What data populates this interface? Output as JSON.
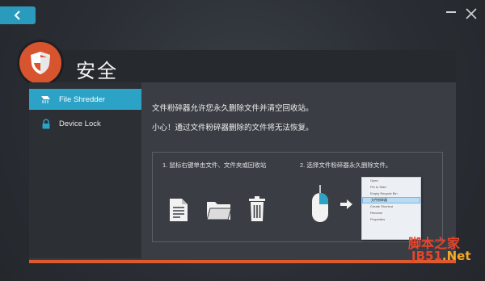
{
  "window": {
    "back_icon": "chevron-left-icon",
    "minimize_icon": "minimize-icon",
    "close_icon": "close-icon"
  },
  "header": {
    "title": "安全",
    "badge_icon": "shield-icon",
    "badge_color": "#d8542f"
  },
  "sidebar": {
    "items": [
      {
        "label": "File Shredder",
        "icon": "shredder-icon",
        "active": true
      },
      {
        "label": "Device Lock",
        "icon": "lock-icon",
        "active": false
      }
    ],
    "accent": "#2ca2c6"
  },
  "content": {
    "line1": "文件粉碎器允许您永久删除文件并清空回收站。",
    "line2": "小心！通过文件粉碎器删除的文件将无法恢复。",
    "step1": "1. 鼠标右键单击文件、文件夹或回收站",
    "step2": "2. 选择文件粉碎器永久删除文件。",
    "context_menu": [
      "Open",
      "Pin to Start",
      "Empty Recycle Bin",
      "文件粉碎器",
      "Create Shortcut",
      "Rename",
      "Properties"
    ]
  },
  "watermark": {
    "line1": "脚本之家",
    "line2": "JB51",
    "line2_suffix": ".Net"
  }
}
